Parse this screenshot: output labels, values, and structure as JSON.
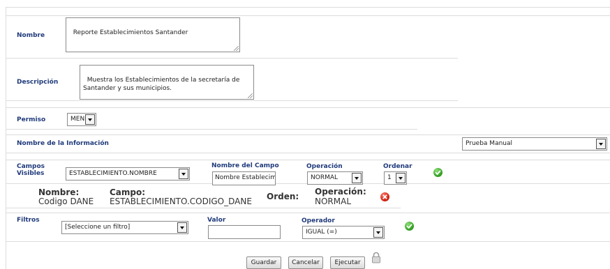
{
  "nombre": {
    "label": "Nombre",
    "value": "Reporte Establecimientos Santander"
  },
  "descripcion": {
    "label": "Descripción",
    "value": "Muestra los Establecimientos de la secretaría de Santander y sus municipios."
  },
  "permiso": {
    "label": "Permiso",
    "selected": "MEN"
  },
  "informacion": {
    "label": "Nombre de la Información",
    "selected": "Prueba Manual"
  },
  "campos": {
    "label_line1": "Campos",
    "label_line2": "Visibles",
    "field_selected": "ESTABLECIMIENTO.NOMBRE",
    "nombre_campo_label": "Nombre del Campo",
    "nombre_campo_value": "Nombre Establecimien",
    "operacion_label": "Operación",
    "operacion_selected": "NORMAL",
    "ordenar_label": "Ordenar",
    "ordenar_selected": "1"
  },
  "entry": {
    "nombre_label": "Nombre:",
    "nombre_value": "Codigo DANE",
    "campo_label": "Campo:",
    "campo_value": "ESTABLECIMIENTO.CODIGO_DANE",
    "orden_label": "Orden:",
    "operacion_label": "Operación:",
    "operacion_value": "NORMAL"
  },
  "filtros": {
    "label": "Filtros",
    "filter_selected": "[Seleccione un filtro]",
    "valor_label": "Valor",
    "valor_value": "",
    "operador_label": "Operador",
    "operador_selected": "IGUAL (=)"
  },
  "actions": {
    "guardar": "Guardar",
    "cancelar": "Cancelar",
    "ejecutar": "Ejecutar"
  },
  "colors": {
    "label_blue": "#1f3a7a",
    "ok_green": "#2f9a1e",
    "remove_red": "#cc1a0a"
  },
  "icons": [
    "chevron-down-icon",
    "check-circle-icon",
    "remove-circle-icon",
    "lock-icon",
    "resize-grip-icon"
  ]
}
